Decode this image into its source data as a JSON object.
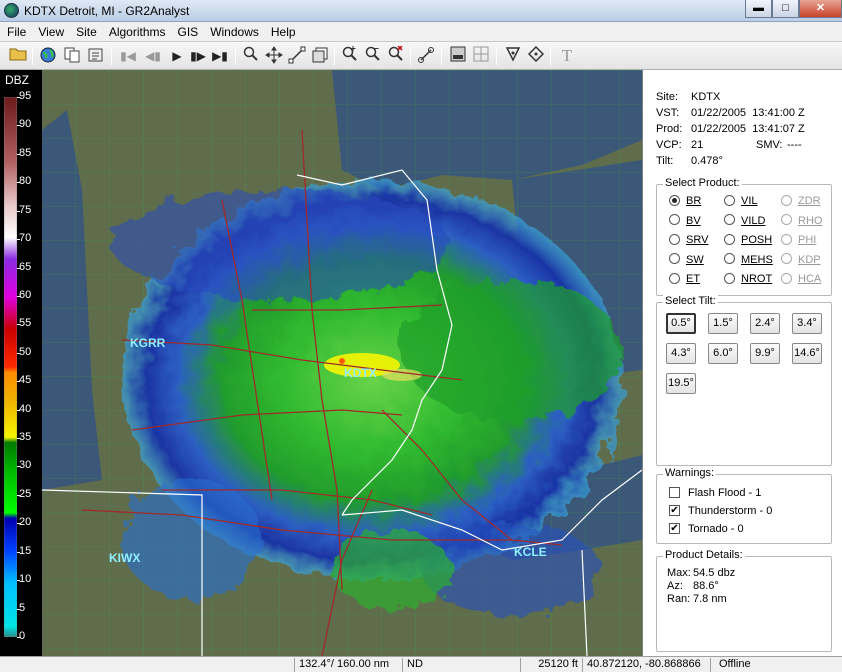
{
  "window": {
    "title": "KDTX Detroit, MI - GR2Analyst"
  },
  "menu": [
    "File",
    "View",
    "Site",
    "Algorithms",
    "GIS",
    "Windows",
    "Help"
  ],
  "colorbar": {
    "unit": "DBZ",
    "labels": [
      "95",
      "90",
      "85",
      "80",
      "75",
      "70",
      "65",
      "60",
      "55",
      "50",
      "45",
      "40",
      "35",
      "30",
      "25",
      "20",
      "15",
      "10",
      "5",
      "0"
    ]
  },
  "map": {
    "radar_sites": [
      "KGRR",
      "KDTX",
      "KIWX",
      "KCLE"
    ]
  },
  "site_info": {
    "site_label": "Site:",
    "site": "KDTX",
    "vst_label": "VST:",
    "vst": "01/22/2005  13:41:00 Z",
    "prod_label": "Prod:",
    "prod": "01/22/2005  13:41:07 Z",
    "vcp_label": "VCP:",
    "vcp": "21",
    "smv_label": "SMV:",
    "smv": "----",
    "tilt_label": "Tilt:",
    "tilt": "0.478°"
  },
  "select_product": {
    "title": "Select Product:",
    "products": [
      {
        "label": "BR",
        "selected": true,
        "enabled": true
      },
      {
        "label": "VIL",
        "selected": false,
        "enabled": true
      },
      {
        "label": "ZDR",
        "selected": false,
        "enabled": false
      },
      {
        "label": "BV",
        "selected": false,
        "enabled": true
      },
      {
        "label": "VILD",
        "selected": false,
        "enabled": true
      },
      {
        "label": "RHO",
        "selected": false,
        "enabled": false
      },
      {
        "label": "SRV",
        "selected": false,
        "enabled": true
      },
      {
        "label": "POSH",
        "selected": false,
        "enabled": true
      },
      {
        "label": "PHI",
        "selected": false,
        "enabled": false
      },
      {
        "label": "SW",
        "selected": false,
        "enabled": true
      },
      {
        "label": "MEHS",
        "selected": false,
        "enabled": true
      },
      {
        "label": "KDP",
        "selected": false,
        "enabled": false
      },
      {
        "label": "ET",
        "selected": false,
        "enabled": true
      },
      {
        "label": "NROT",
        "selected": false,
        "enabled": true
      },
      {
        "label": "HCA",
        "selected": false,
        "enabled": false
      }
    ]
  },
  "select_tilt": {
    "title": "Select Tilt:",
    "tilts": [
      {
        "label": "0.5°",
        "selected": true
      },
      {
        "label": "1.5°",
        "selected": false
      },
      {
        "label": "2.4°",
        "selected": false
      },
      {
        "label": "3.4°",
        "selected": false
      },
      {
        "label": "4.3°",
        "selected": false
      },
      {
        "label": "6.0°",
        "selected": false
      },
      {
        "label": "9.9°",
        "selected": false
      },
      {
        "label": "14.6°",
        "selected": false
      },
      {
        "label": "19.5°",
        "selected": false
      }
    ]
  },
  "warnings": {
    "title": "Warnings:",
    "items": [
      {
        "label": "Flash Flood - 1",
        "checked": false
      },
      {
        "label": "Thunderstorm - 0",
        "checked": true
      },
      {
        "label": "Tornado - 0",
        "checked": true
      }
    ]
  },
  "product_details": {
    "title": "Product Details:",
    "max_label": "Max:",
    "max": "54.5 dbz",
    "az_label": "Az:",
    "az": "88.6°",
    "ran_label": "Ran:",
    "ran": "7.8 nm"
  },
  "statusbar": {
    "azimuth_range": "132.4°/ 160.00 nm",
    "value": "ND",
    "height": "25120 ft",
    "coords": "40.872120, -80.868866",
    "mode": "Offline"
  },
  "colors": {
    "map_land": "#5f6d4c",
    "map_lake": "#3b5878",
    "county_lines": "#3fa046",
    "highways": "#a02a2a",
    "state_lines": "#ffffff",
    "site_label": "#8ff0ff"
  }
}
